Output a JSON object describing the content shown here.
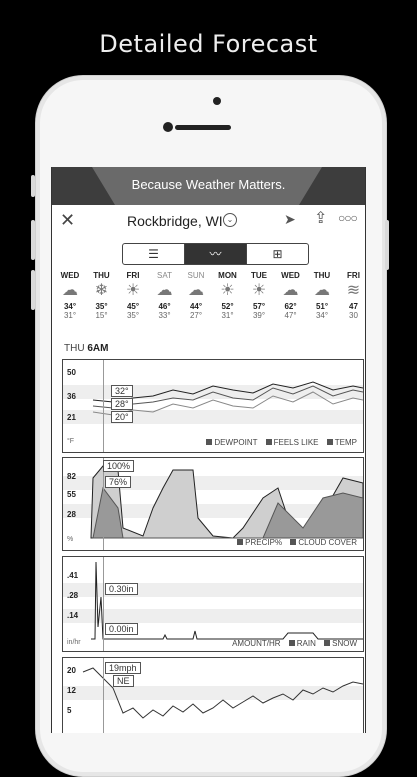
{
  "caption": "Detailed Forecast",
  "banner": "Because Weather Matters.",
  "header": {
    "location": "Rockbridge, WI"
  },
  "days": [
    {
      "name": "WED",
      "hi": "34°",
      "lo": "31°",
      "icon": "snow-cloud-icon",
      "glyph": "☁",
      "light": false
    },
    {
      "name": "THU",
      "hi": "35°",
      "lo": "15°",
      "icon": "snowflake-icon",
      "glyph": "❄",
      "light": false
    },
    {
      "name": "FRI",
      "hi": "45°",
      "lo": "35°",
      "icon": "sun-icon",
      "glyph": "☀",
      "light": false
    },
    {
      "name": "SAT",
      "hi": "46°",
      "lo": "33°",
      "icon": "rain-cloud-icon",
      "glyph": "☁",
      "light": true
    },
    {
      "name": "SUN",
      "hi": "44°",
      "lo": "27°",
      "icon": "snow-cloud-icon",
      "glyph": "☁",
      "light": true
    },
    {
      "name": "MON",
      "hi": "52°",
      "lo": "31°",
      "icon": "sun-icon",
      "glyph": "☀",
      "light": false
    },
    {
      "name": "TUE",
      "hi": "57°",
      "lo": "39°",
      "icon": "sun-icon",
      "glyph": "☀",
      "light": false
    },
    {
      "name": "WED",
      "hi": "62°",
      "lo": "47°",
      "icon": "rain-cloud-icon",
      "glyph": "☁",
      "light": false
    },
    {
      "name": "THU",
      "hi": "51°",
      "lo": "34°",
      "icon": "rain-cloud-icon",
      "glyph": "☁",
      "light": false
    },
    {
      "name": "FRI",
      "hi": "47",
      "lo": "30",
      "icon": "fog-icon",
      "glyph": "≋",
      "light": false
    }
  ],
  "time": {
    "day": "THU",
    "hour": "6AM"
  },
  "temp_panel": {
    "yticks": [
      "50",
      "36",
      "21"
    ],
    "unit": "°F",
    "legend": [
      "DEWPOINT",
      "FEELS LIKE",
      "TEMP"
    ],
    "tips": [
      "32°",
      "28°",
      "20°"
    ]
  },
  "precip_panel": {
    "yticks": [
      "82",
      "55",
      "28"
    ],
    "unit": "%",
    "legend": [
      "PRECIP%",
      "CLOUD COVER"
    ],
    "tips": [
      "100%",
      "76%"
    ]
  },
  "amount_panel": {
    "yticks": [
      ".41",
      ".28",
      ".14"
    ],
    "unit": "in/hr",
    "legend_title": "AMOUNT/HR",
    "legend": [
      "RAIN",
      "SNOW"
    ],
    "tips": [
      "0.30in",
      "0.00in"
    ]
  },
  "wind_panel": {
    "yticks": [
      "20",
      "12",
      "5"
    ],
    "tips": [
      "19mph",
      "NE"
    ]
  }
}
